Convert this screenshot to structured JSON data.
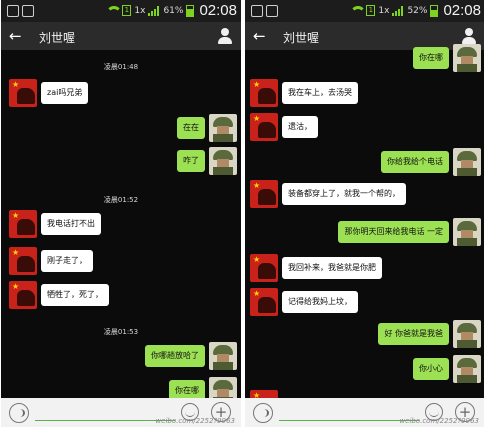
{
  "phones": [
    {
      "status": {
        "time": "02:08",
        "network": "1x",
        "battery": "61%",
        "battery_level": 0.61
      },
      "header": {
        "title": "刘世喔"
      },
      "timestamps": [
        "凌晨01:48",
        "凌晨01:52",
        "凌晨01:53"
      ],
      "messages": [
        {
          "side": "in",
          "text": "zai吗兄弟"
        },
        {
          "side": "out",
          "text": "在在"
        },
        {
          "side": "out",
          "text": "咋了"
        },
        {
          "side": "in",
          "text": "我电话打不出"
        },
        {
          "side": "in",
          "text": "刚子走了，"
        },
        {
          "side": "in",
          "text": "牺牲了，死了，"
        },
        {
          "side": "out",
          "text": "你哪趟放哈了"
        },
        {
          "side": "out",
          "text": "你在哪"
        }
      ],
      "watermark": "weibo.com/2252?9963"
    },
    {
      "status": {
        "time": "02:08",
        "network": "1x",
        "battery": "52%",
        "battery_level": 0.52
      },
      "header": {
        "title": "刘世喔"
      },
      "messages": [
        {
          "side": "out",
          "text": "你在哪"
        },
        {
          "side": "in",
          "text": "我在车上，去汤哭"
        },
        {
          "side": "in",
          "text": "遗沽，"
        },
        {
          "side": "out",
          "text": "你给我给个电话"
        },
        {
          "side": "in",
          "text": "装备都穿上了，就我一个帮的，"
        },
        {
          "side": "out",
          "text": "那你明天回来给我电话 一定"
        },
        {
          "side": "in",
          "text": "我回补来，我爸就是你肥"
        },
        {
          "side": "in",
          "text": "记得给我妈上坟，"
        },
        {
          "side": "out",
          "text": "好 你爸就是我爸"
        },
        {
          "side": "out",
          "text": "你小心"
        }
      ],
      "watermark": "weibo.com/2252?9963"
    }
  ]
}
